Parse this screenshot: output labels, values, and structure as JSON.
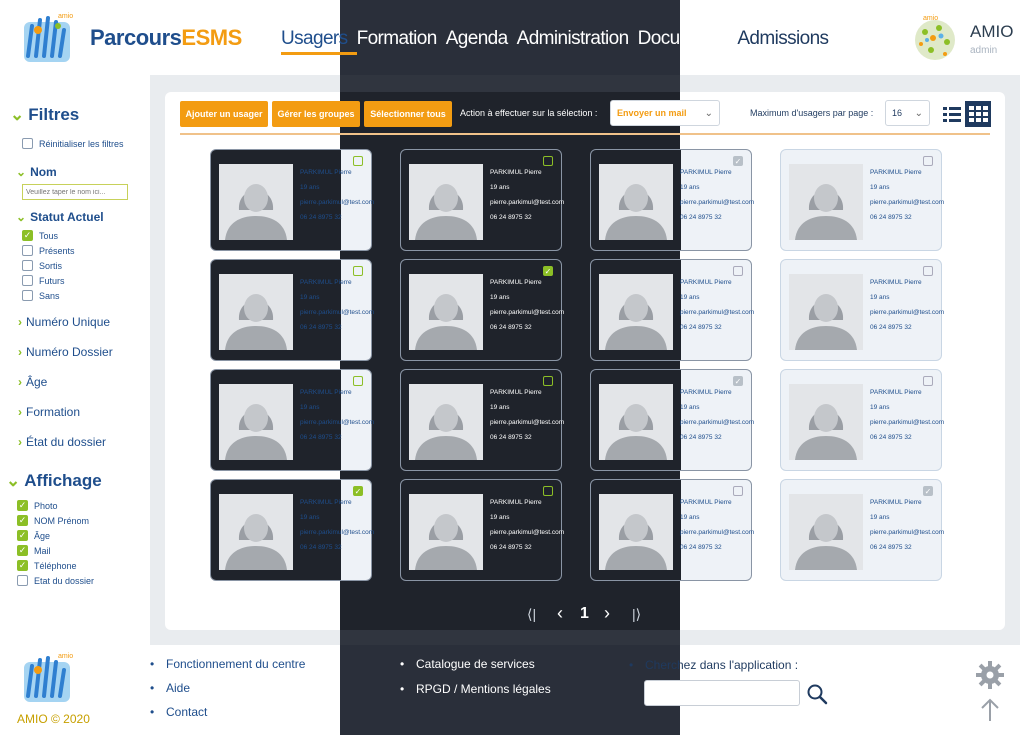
{
  "header": {
    "brand_part1": "Parcours",
    "brand_part2": "ESMS",
    "nav": [
      "Usagers",
      "Formation",
      "Agenda",
      "Administration",
      "Documents",
      "Admissions"
    ],
    "user_name": "AMIO",
    "user_role": "admin"
  },
  "sidebar": {
    "filters_title": "Filtres",
    "reset_label": "Réinitialiser les filtres",
    "name_section": "Nom",
    "name_placeholder": "Veuillez taper le nom ici...",
    "status_section": "Statut Actuel",
    "status_options": [
      {
        "label": "Tous",
        "checked": true
      },
      {
        "label": "Présents",
        "checked": false
      },
      {
        "label": "Sortis",
        "checked": false
      },
      {
        "label": "Futurs",
        "checked": false
      },
      {
        "label": "Sans",
        "checked": false
      }
    ],
    "collapsed_sections": [
      "Numéro Unique",
      "Numéro Dossier",
      "Âge",
      "Formation",
      "État du dossier"
    ],
    "display_title": "Affichage",
    "display_options": [
      {
        "label": "Photo",
        "checked": true
      },
      {
        "label": "NOM Prénom",
        "checked": true
      },
      {
        "label": "Âge",
        "checked": true
      },
      {
        "label": "Mail",
        "checked": true
      },
      {
        "label": "Téléphone",
        "checked": true
      },
      {
        "label": "Etat du dossier",
        "checked": false
      }
    ]
  },
  "toolbar": {
    "add_user": "Ajouter un usager",
    "manage_groups": "Gérer les groupes",
    "select_all": "Sélectionner tous",
    "action_label": "Action à effectuer sur la sélection :",
    "action_value": "Envoyer un mail",
    "max_label": "Maximum d'usagers par page :",
    "max_value": "16"
  },
  "card": {
    "name": "PARKIMUL Pierre",
    "age": "19 ans",
    "email": "pierre.parkimul@test.com",
    "phone": "06 24 8975 32"
  },
  "pager": {
    "first": "⟨|",
    "prev": "‹",
    "page": "1",
    "next": "›",
    "last": "|⟩"
  },
  "footer": {
    "copyright": "AMIO © 2020",
    "col1": [
      "Fonctionnement du centre",
      "Aide",
      "Contact"
    ],
    "col2": [
      "Catalogue de services",
      "RPGD / Mentions légales"
    ],
    "search_label": "Cherchez dans l'application :"
  }
}
